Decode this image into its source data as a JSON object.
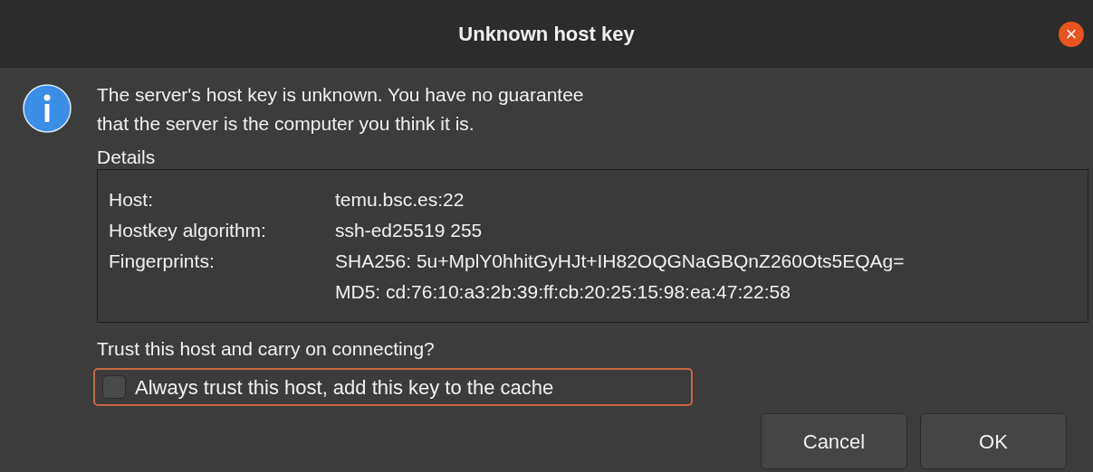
{
  "window": {
    "title": "Unknown host key",
    "close": "×"
  },
  "message": [
    "The server's host key is unknown. You have no guarantee",
    "that the server is the computer you think it is."
  ],
  "details": {
    "legend": "Details",
    "rows": [
      {
        "label": "Host:",
        "values": [
          "temu.bsc.es:22"
        ]
      },
      {
        "label": "Hostkey algorithm:",
        "values": [
          "ssh-ed25519 255"
        ]
      },
      {
        "label": "Fingerprints:",
        "values": [
          "SHA256: 5u+MplY0hhitGyHJt+IH82OQGNaGBQnZ260Ots5EQAg=",
          "MD5: cd:76:10:a3:2b:39:ff:cb:20:25:15:98:ea:47:22:58"
        ]
      }
    ]
  },
  "question": "Trust this host and carry on connecting?",
  "checkbox": {
    "label": "Always trust this host, add this key to the cache",
    "checked": false,
    "focused": true
  },
  "buttons": [
    "Cancel",
    "OK"
  ]
}
